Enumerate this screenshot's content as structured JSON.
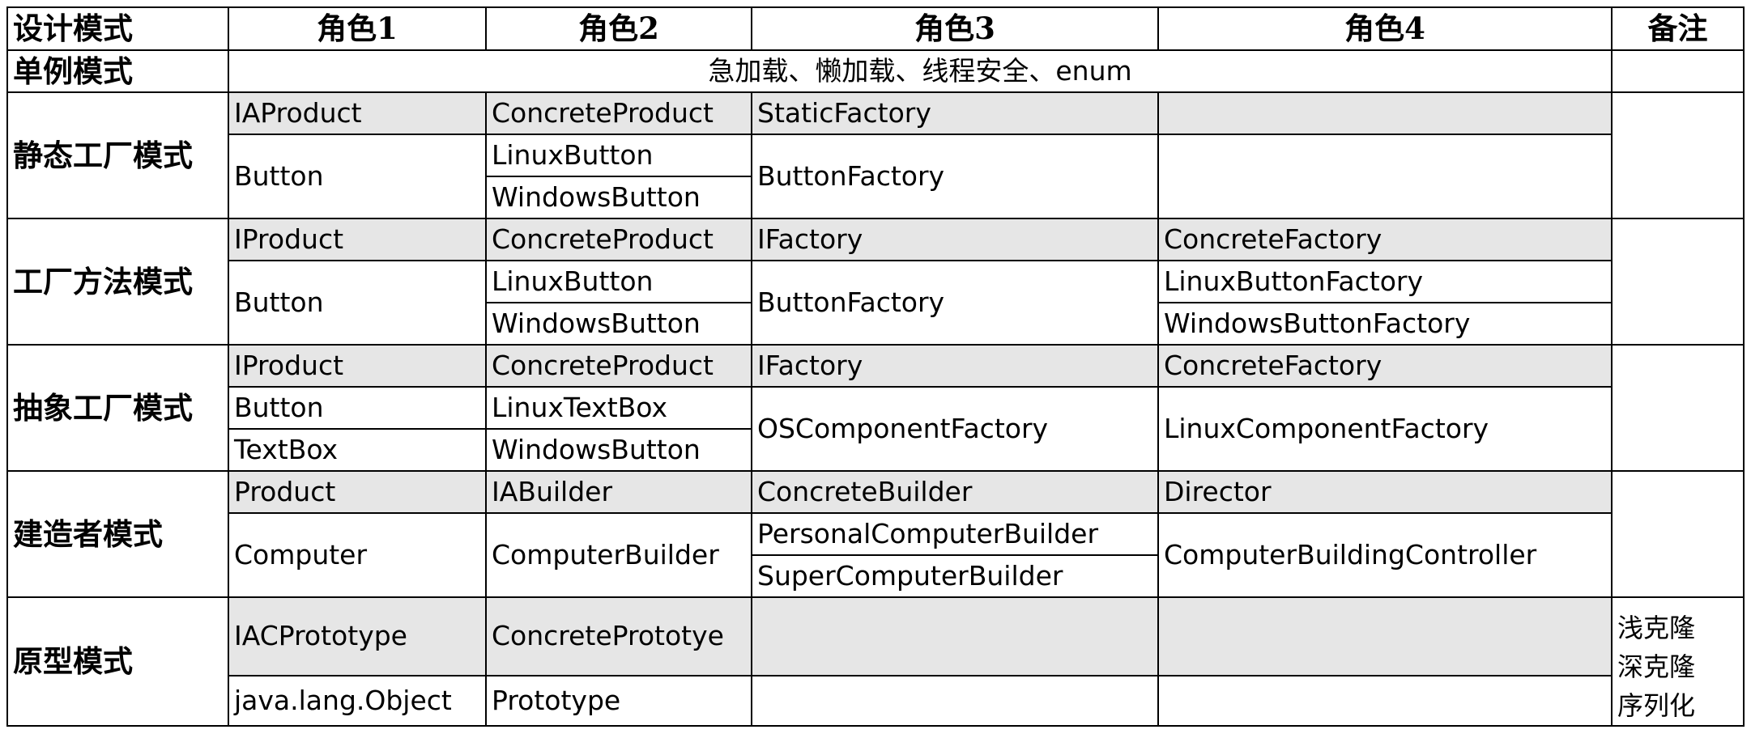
{
  "header": {
    "col0": "设计模式",
    "col1": "角色1",
    "col2": "角色2",
    "col3": "角色3",
    "col4": "角色4",
    "col5": "备注"
  },
  "singleton": {
    "name": "单例模式",
    "desc": "急加载、懒加载、线程安全、enum"
  },
  "static_factory": {
    "name": "静态工厂模式",
    "r1": [
      "IAProduct",
      "ConcreteProduct",
      "StaticFactory",
      ""
    ],
    "r2_c1": "Button",
    "r2_c2": "LinuxButton",
    "r2_c3": "ButtonFactory",
    "r3_c2": "WindowsButton"
  },
  "factory_method": {
    "name": "工厂方法模式",
    "r1": [
      "IProduct",
      "ConcreteProduct",
      "IFactory",
      "ConcreteFactory"
    ],
    "r2_c1": "Button",
    "r2_c2": "LinuxButton",
    "r2_c3": "ButtonFactory",
    "r2_c4": "LinuxButtonFactory",
    "r3_c2": "WindowsButton",
    "r3_c4": "WindowsButtonFactory"
  },
  "abstract_factory": {
    "name": "抽象工厂模式",
    "r1": [
      "IProduct",
      "ConcreteProduct",
      "IFactory",
      "ConcreteFactory"
    ],
    "r2_c1": "Button",
    "r2_c2": "LinuxTextBox",
    "r2_c3": "OSComponentFactory",
    "r2_c4": "LinuxComponentFactory",
    "r3_c1": "TextBox",
    "r3_c2": "WindowsButton"
  },
  "builder": {
    "name": "建造者模式",
    "r1": [
      "Product",
      "IABuilder",
      "ConcreteBuilder",
      "Director"
    ],
    "r2_c1": "Computer",
    "r2_c2": "ComputerBuilder",
    "r2_c3": "PersonalComputerBuilder",
    "r2_c4": "ComputerBuildingController",
    "r3_c3": "SuperComputerBuilder"
  },
  "prototype": {
    "name": "原型模式",
    "r1": [
      "IACPrototype",
      "ConcretePrototye",
      "",
      ""
    ],
    "r2": [
      "java.lang.Object",
      "Prototype",
      "",
      ""
    ],
    "note": [
      "浅克隆",
      "深克隆",
      "序列化"
    ]
  }
}
